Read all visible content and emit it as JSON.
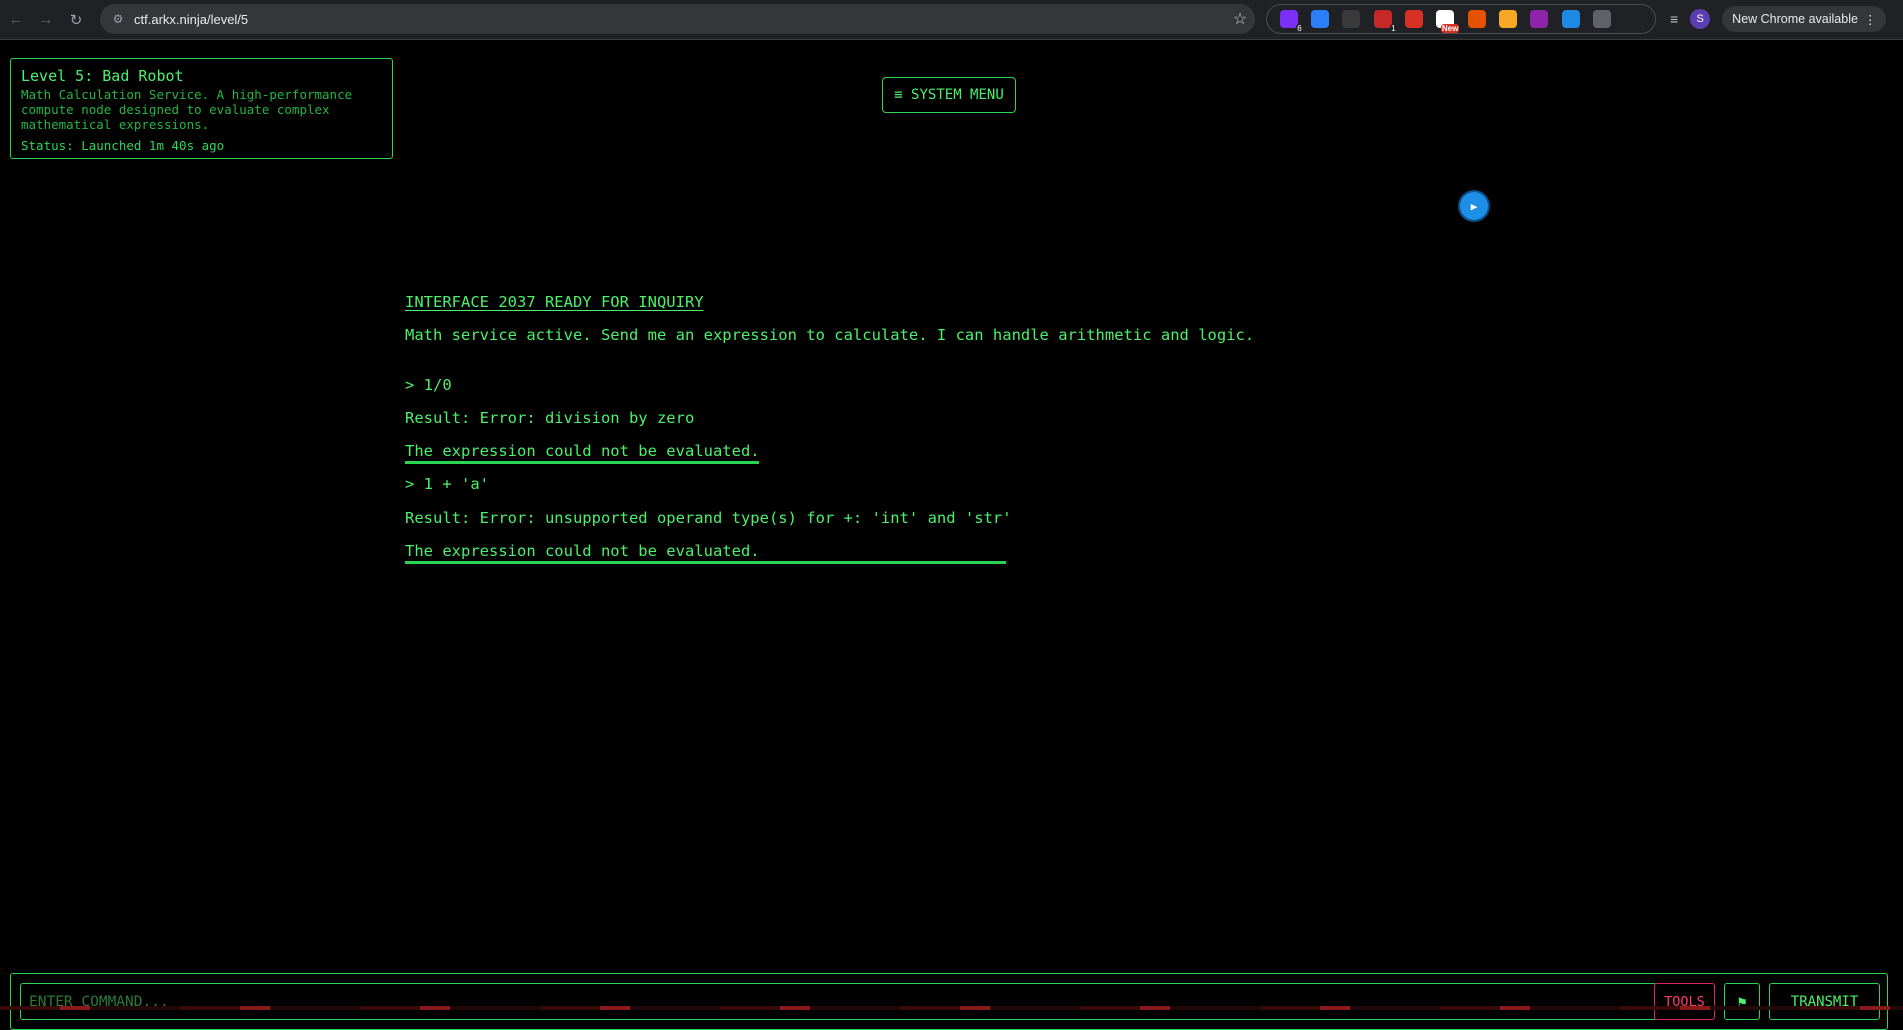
{
  "browser": {
    "url": "ctf.arkx.ninja/level/5",
    "update_label": "New Chrome available",
    "avatar_letter": "S",
    "extensions": [
      {
        "name": "purple-extension-icon",
        "badge": "6",
        "color": "#7b2ff7"
      },
      {
        "name": "fj-extension-icon",
        "badge": "",
        "color": "#2d7ff9"
      },
      {
        "name": "v-extension-icon",
        "badge": "",
        "color": "#3a3a3a"
      },
      {
        "name": "red-extension-icon",
        "badge": "1",
        "color": "#c62828"
      },
      {
        "name": "camera-extension-icon",
        "badge": "",
        "color": "#d93025"
      },
      {
        "name": "new-extension-icon",
        "badge": "New",
        "color": "#ffffff"
      },
      {
        "name": "cookie-extension-icon",
        "badge": "",
        "color": "#e65100"
      },
      {
        "name": "smiley-extension-icon",
        "badge": "",
        "color": "#f9a825"
      },
      {
        "name": "diamond-extension-icon",
        "badge": "",
        "color": "#8e24aa"
      },
      {
        "name": "image-extension-icon",
        "badge": "",
        "color": "#1e88e5"
      },
      {
        "name": "cursor-extension-icon",
        "badge": "",
        "color": "#5f6368"
      },
      {
        "name": "puzzle-extension-icon",
        "badge": "",
        "color": "#202124"
      }
    ]
  },
  "level": {
    "title": "Level 5: Bad Robot",
    "description_lines": [
      "Math Calculation Service. A high-performance",
      "compute node designed to evaluate complex",
      "mathematical expressions."
    ],
    "status": "Status: Launched 1m 40s ago"
  },
  "system_menu": {
    "label": "≡ SYSTEM MENU"
  },
  "terminal": {
    "header": "INTERFACE 2037 READY FOR INQUIRY",
    "intro": "Math service active. Send me an expression to calculate. I can handle arithmetic and logic.",
    "entries": [
      {
        "prompt": "> 1/0",
        "result": "Result: Error: division by zero",
        "note": "The expression could not be evaluated."
      },
      {
        "prompt": "> 1 + 'a'",
        "result": "Result: Error: unsupported operand type(s) for +: 'int' and 'str'",
        "note": "The expression could not be evaluated."
      }
    ]
  },
  "command_bar": {
    "placeholder": "ENTER COMMAND...",
    "value": "",
    "tools_label": "TOOLS",
    "flag_label": "⚑",
    "transmit_label": "TRANSMIT"
  },
  "colors": {
    "terminal_green": "#4cf06b",
    "border_green": "#2bd44f",
    "tools_red": "#ff3a73",
    "background": "#000000"
  }
}
